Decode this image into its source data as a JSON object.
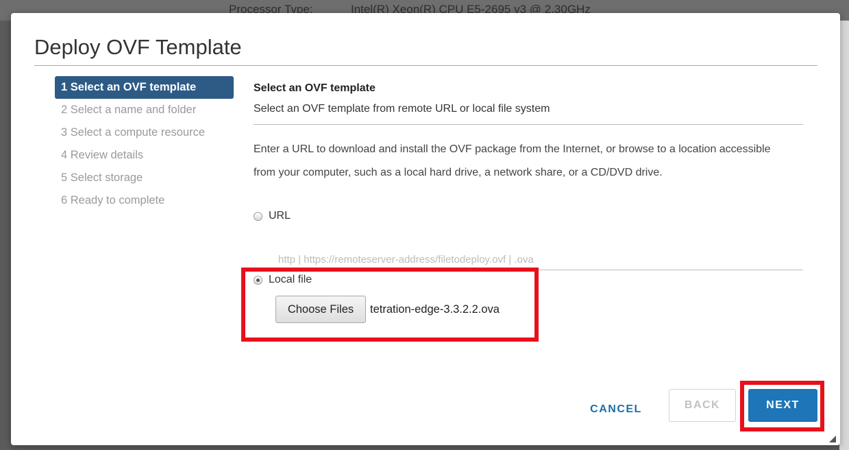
{
  "background": {
    "label": "Processor Type:",
    "value": "Intel(R) Xeon(R) CPU E5-2695 v3 @ 2.30GHz"
  },
  "dialog": {
    "title": "Deploy OVF Template",
    "steps": [
      {
        "label": "1 Select an OVF template",
        "active": true
      },
      {
        "label": "2 Select a name and folder",
        "active": false
      },
      {
        "label": "3 Select a compute resource",
        "active": false
      },
      {
        "label": "4 Review details",
        "active": false
      },
      {
        "label": "5 Select storage",
        "active": false
      },
      {
        "label": "6 Ready to complete",
        "active": false
      }
    ],
    "section_title": "Select an OVF template",
    "section_subtitle": "Select an OVF template from remote URL or local file system",
    "description": "Enter a URL to download and install the OVF package from the Internet, or browse to a location accessible from your computer, such as a local hard drive, a network share, or a CD/DVD drive.",
    "source_options": {
      "url_label": "URL",
      "url_selected": false,
      "url_placeholder": "http | https://remoteserver-address/filetodeploy.ovf | .ova",
      "url_value": "",
      "local_label": "Local file",
      "local_selected": true
    },
    "choose_files_label": "Choose Files",
    "selected_file": "tetration-edge-3.3.2.2.ova",
    "buttons": {
      "cancel": "CANCEL",
      "back": "BACK",
      "next": "NEXT"
    }
  },
  "colors": {
    "accent": "#1e75b7",
    "active_step": "#2e5a86",
    "highlight": "#e8101a"
  }
}
